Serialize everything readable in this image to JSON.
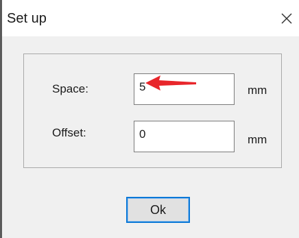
{
  "window": {
    "title": "Set up",
    "close_icon": "close-icon"
  },
  "form": {
    "space": {
      "label": "Space:",
      "value": "5",
      "unit": "mm"
    },
    "offset": {
      "label": "Offset:",
      "value": "0",
      "unit": "mm"
    }
  },
  "annotation": {
    "arrow_icon": "red-arrow-icon",
    "color": "#e8262b"
  },
  "buttons": {
    "ok_label": "Ok"
  },
  "colors": {
    "dialog_bg": "#f0f0f0",
    "focus_border": "#0a78d7",
    "arrow": "#e8262b"
  }
}
